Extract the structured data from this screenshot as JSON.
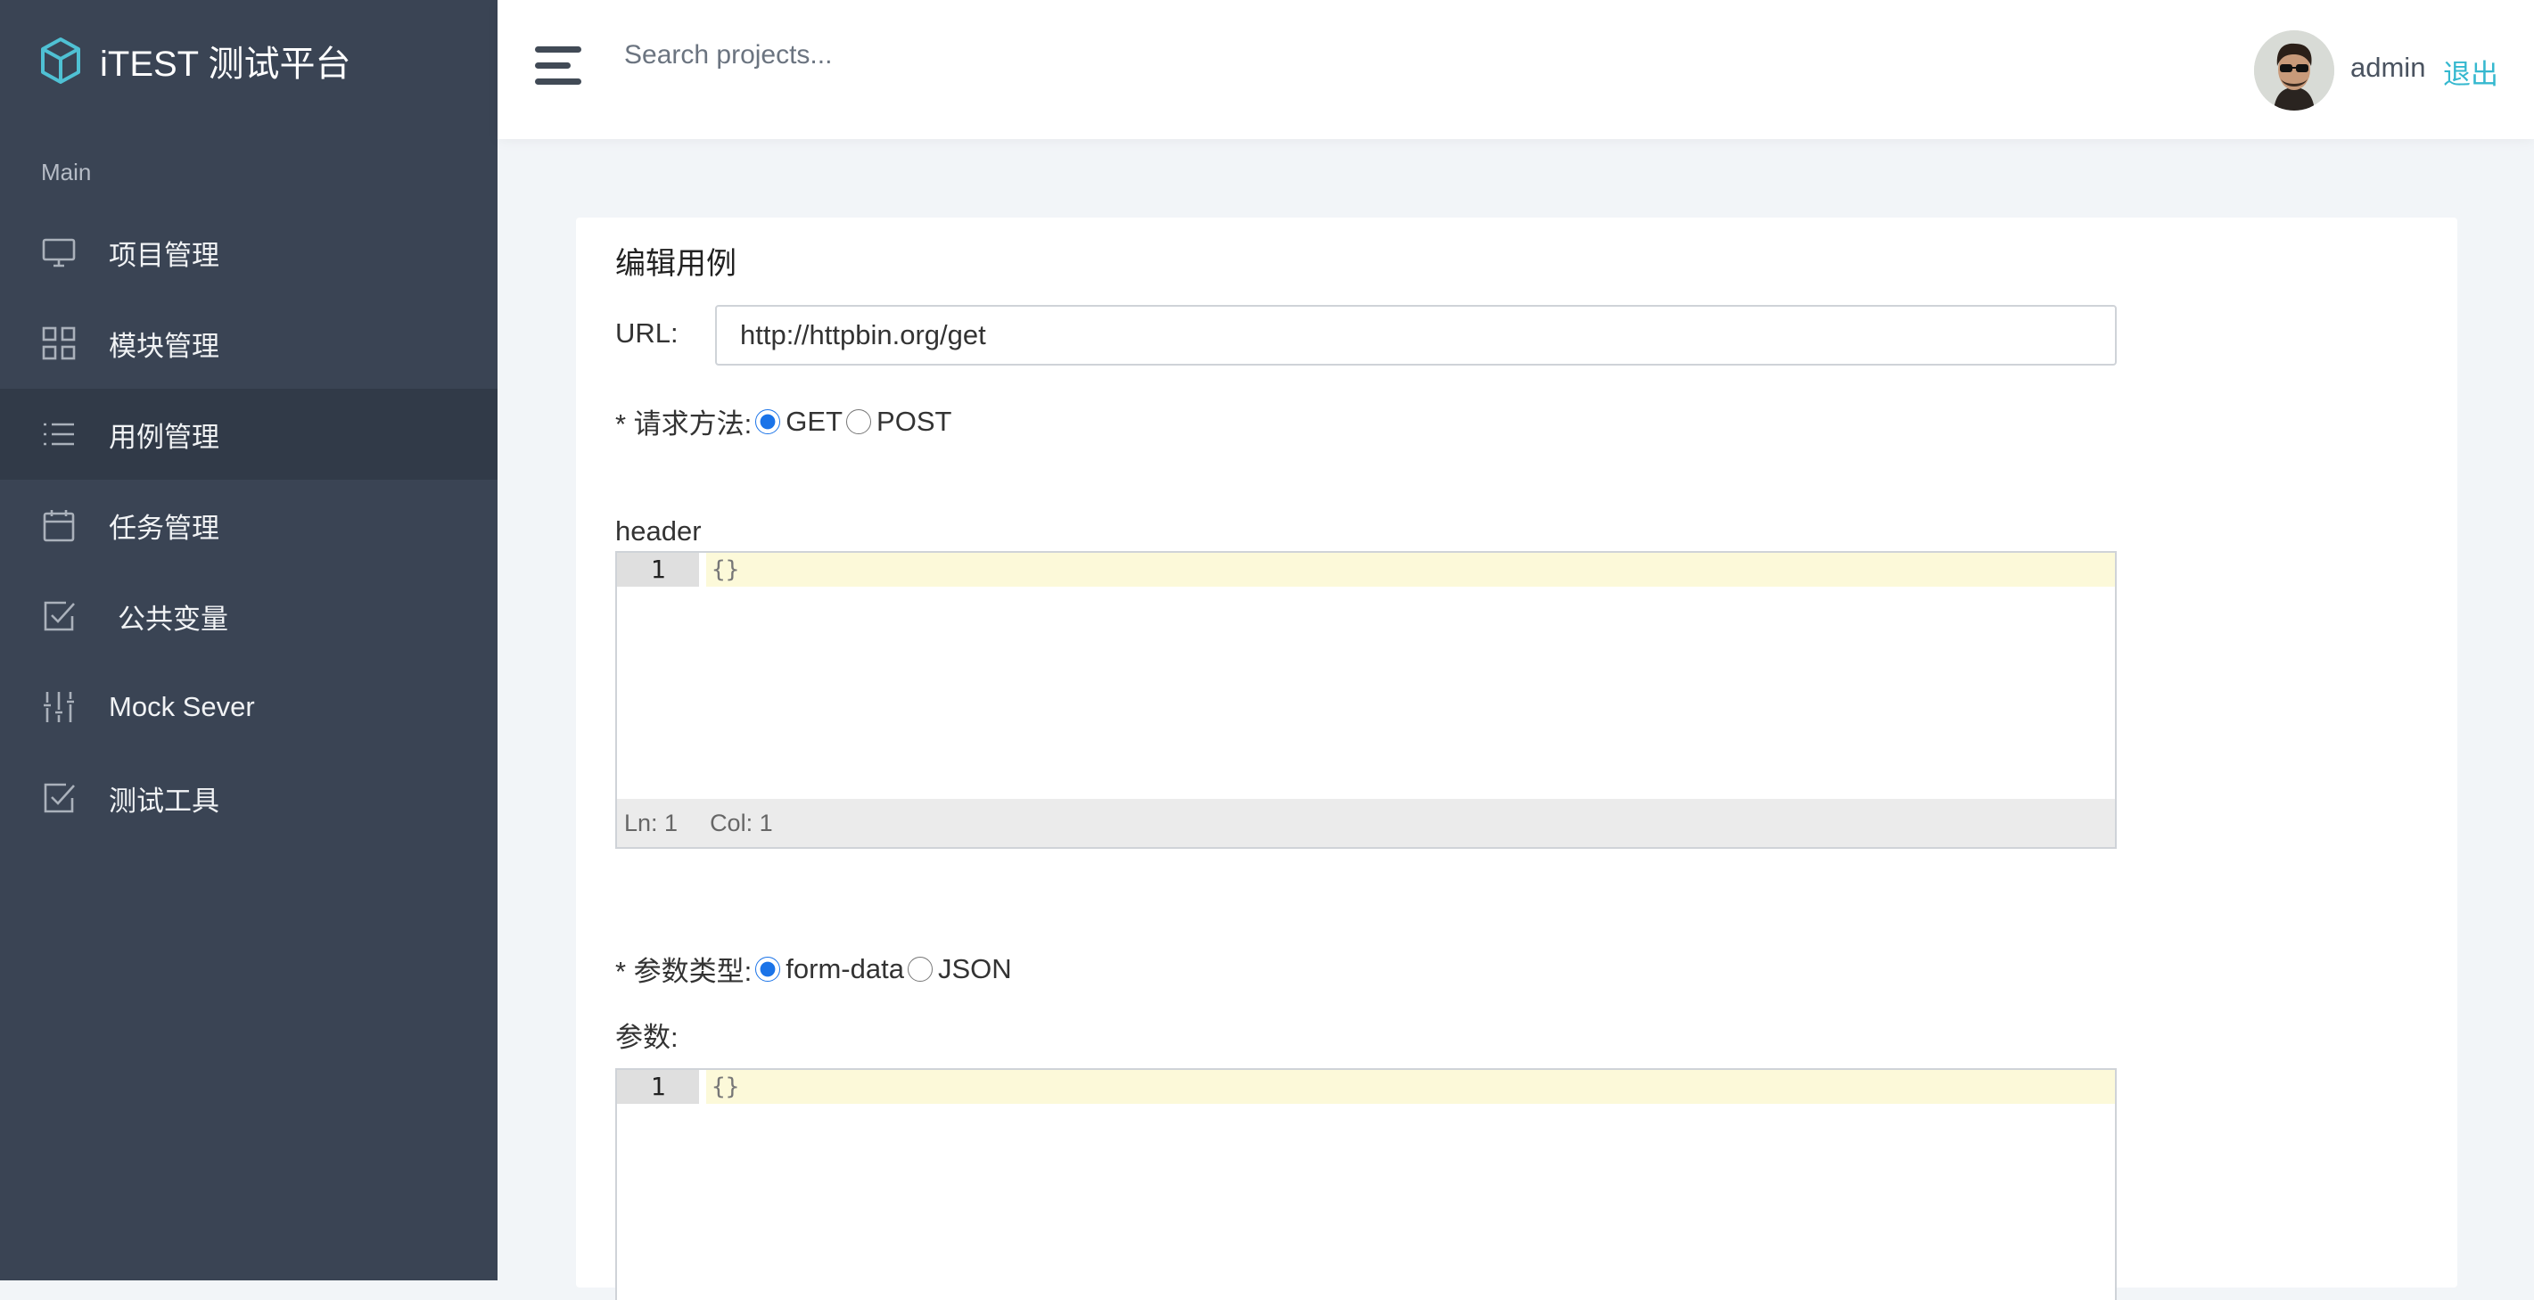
{
  "app": {
    "title": "iTEST 测试平台"
  },
  "sidebar": {
    "section": "Main",
    "items": [
      {
        "label": "项目管理",
        "icon": "monitor-icon"
      },
      {
        "label": "模块管理",
        "icon": "grid-icon"
      },
      {
        "label": "用例管理",
        "icon": "list-icon",
        "active": true
      },
      {
        "label": "任务管理",
        "icon": "calendar-icon"
      },
      {
        "label": "公共变量",
        "icon": "checkbox-icon"
      },
      {
        "label": "Mock Sever",
        "icon": "sliders-icon"
      },
      {
        "label": "测试工具",
        "icon": "checkbox-icon"
      }
    ]
  },
  "header": {
    "search_placeholder": "Search projects...",
    "username": "admin",
    "logout": "退出"
  },
  "form": {
    "title": "编辑用例",
    "url_label": "URL:",
    "url_value": "http://httpbin.org/get",
    "method_label": "* 请求方法:",
    "methods": [
      "GET",
      "POST"
    ],
    "method_selected": "GET",
    "header_label": "header",
    "header_editor": {
      "line_number": "1",
      "code": "{}",
      "status_ln": "Ln: 1",
      "status_col": "Col: 1"
    },
    "param_type_label": "* 参数类型:",
    "param_types": [
      "form-data",
      "JSON"
    ],
    "param_type_selected": "form-data",
    "params_label": "参数:",
    "params_editor": {
      "line_number": "1",
      "code": "{}"
    }
  },
  "colors": {
    "sidebar_bg": "#3a4454",
    "sidebar_active": "#313a48",
    "accent": "#35b8cf",
    "radio": "#1a73e8"
  }
}
